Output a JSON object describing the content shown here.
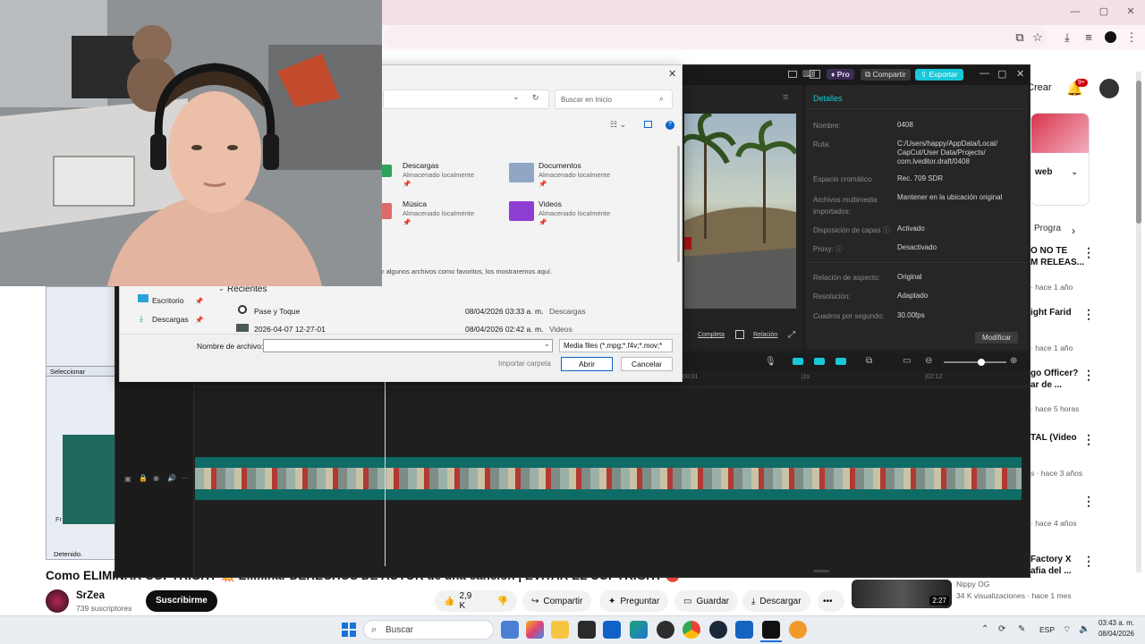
{
  "browser": {
    "window_controls": [
      "—",
      "▢",
      "✕"
    ]
  },
  "youtube": {
    "header": {
      "create_label": "Crear",
      "notif_count": "9+"
    },
    "recs": [
      {
        "title": "",
        "meta": ""
      },
      {
        "title": "Progra",
        "meta": ""
      },
      {
        "title": "O NO TE\nM RELEAS...",
        "meta": "· hace 1 año"
      },
      {
        "title": "ight Farid",
        "meta": "· hace 1 año"
      },
      {
        "title": "go Officer?\nar de ...",
        "meta": "· hace 5 horas"
      },
      {
        "title": "TAL (Video",
        "meta": "s · hace 3 años"
      },
      {
        "title": "",
        "meta": "· hace 4 años"
      },
      {
        "title": "Factory X\nafia del ...",
        "meta": "Nippy OG"
      }
    ],
    "web_label": "web",
    "last_rec": {
      "channel": "Nippy OG",
      "meta": "34 K visualizaciones · hace 1 mes",
      "duration": "2:27"
    },
    "video": {
      "title": "Como ELIMINAR COPYRIGHT 💥 Eliminar DERECHOS DE AUTOR de una canción | EVITAR EL COPYRIGHT 🔴",
      "channel": "SrZea",
      "subs": "739 suscriptores",
      "subscribe": "Suscribirme",
      "likes": "2,9 K",
      "share": "Compartir",
      "ask": "Preguntar",
      "save": "Guardar",
      "download": "Descargar",
      "more": "•••"
    },
    "left_frag": {
      "select": "Seleccionar",
      "stopped": "Detenido.",
      "fr": "Fr"
    }
  },
  "capcut": {
    "pro": "Pro",
    "share": "Compartir",
    "export": "Exportar",
    "details_title": "Detalles",
    "details": [
      {
        "label": "Nombre:",
        "value": "0408"
      },
      {
        "label": "Ruta:",
        "value": "C:/Users/happy/AppData/Local/\nCapCut/User Data/Projects/\ncom.lveditor.draft/0408"
      },
      {
        "label": "Espacio cromático",
        "value": "Rec. 709 SDR"
      },
      {
        "label": "Archivos multimedia\nimportados:",
        "value": "Mantener en la ubicación original"
      },
      {
        "label": "Disposición de capas ⓘ",
        "value": "Activado"
      },
      {
        "label": "Proxy: ⓘ",
        "value": "Desactivado"
      },
      {
        "label": "Relación de aspecto:",
        "value": "Original"
      },
      {
        "label": "Resolución:",
        "value": "Adaptado"
      },
      {
        "label": "Cuadros por segundo:",
        "value": "30.00fps"
      }
    ],
    "modify": "Modificar",
    "preview_complete": "Completa",
    "preview_ratio": "Relación",
    "timecodes": [
      "|00:01",
      "|1s",
      "|02:12"
    ]
  },
  "dialog": {
    "search_placeholder": "Buscar en Inicio",
    "folders": [
      {
        "name": "Descargas",
        "sub": "Almacenado localmente"
      },
      {
        "name": "Documentos",
        "sub": "Almacenado localmente"
      },
      {
        "name": "Música",
        "sub": "Almacenado localmente"
      },
      {
        "name": "Videos",
        "sub": "Almacenado localmente"
      }
    ],
    "fav_hint": "r algunos archivos como favoritos, los mostraremos aquí.",
    "recent_header": "Recientes",
    "sidebar": [
      "Escritorio",
      "Descargas"
    ],
    "recent_files": [
      {
        "name": "Pase y Toque",
        "date": "08/04/2026 03:33 a. m.",
        "location": "Descargas"
      },
      {
        "name": "2026-04-07 12-27-01",
        "date": "08/04/2026 02:42 a. m.",
        "location": "Videos"
      }
    ],
    "filename_label": "Nombre de archivo:",
    "filename_value": "",
    "filetype": "Media files (*.mpg;*.f4v;*.mov;*",
    "import_folder": "Importar carpeta",
    "open": "Abrir",
    "cancel": "Cancelar"
  },
  "taskbar": {
    "search": "Buscar",
    "lang": "ESP",
    "time": "03:43 a. m.",
    "date": "08/04/2026"
  },
  "colors": {
    "capcut_accent": "#18c8d8",
    "youtube_red": "#ff0000",
    "teal_track": "#0e6b66"
  }
}
